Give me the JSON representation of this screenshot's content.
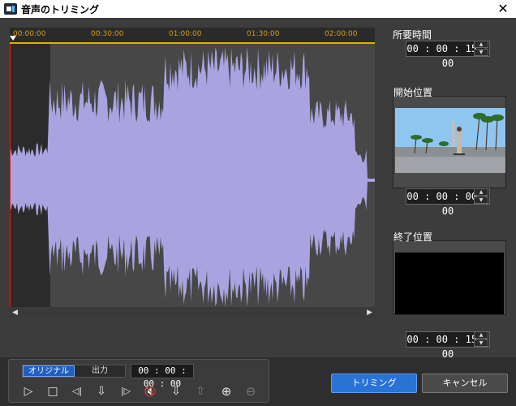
{
  "window": {
    "title": "音声のトリミング",
    "close_label": "✕"
  },
  "timeline": {
    "ticks": [
      "00:00:00",
      "00:30:00",
      "01:00:00",
      "01:30:00",
      "02:00:00"
    ]
  },
  "right": {
    "duration_label": "所要時間",
    "duration_value": "00 : 00 : 15 : 00",
    "start_label": "開始位置",
    "start_value": "00 : 00 : 00 : 00",
    "end_label": "終了位置",
    "end_value": "00 : 00 : 15 : 00"
  },
  "bottom": {
    "mode_original": "オリジナル",
    "mode_output": "出力",
    "timecode": "00 : 00 : 00 : 00",
    "trim_button": "トリミング",
    "cancel_button": "キャンセル"
  },
  "colors": {
    "waveform": "#a9a4e0",
    "accent": "#2a73d6",
    "playhead": "#e21a1a",
    "timeline": "#e0b000"
  },
  "icons": {
    "play": "▷",
    "stop": "□",
    "prev_frame": "◁|",
    "mark_in": "⇩",
    "next_frame": "|▷",
    "mute": "🔇",
    "mark_out": "⇩",
    "clip": "⇧",
    "zoom_in": "⊕",
    "zoom_out": "⊖"
  }
}
